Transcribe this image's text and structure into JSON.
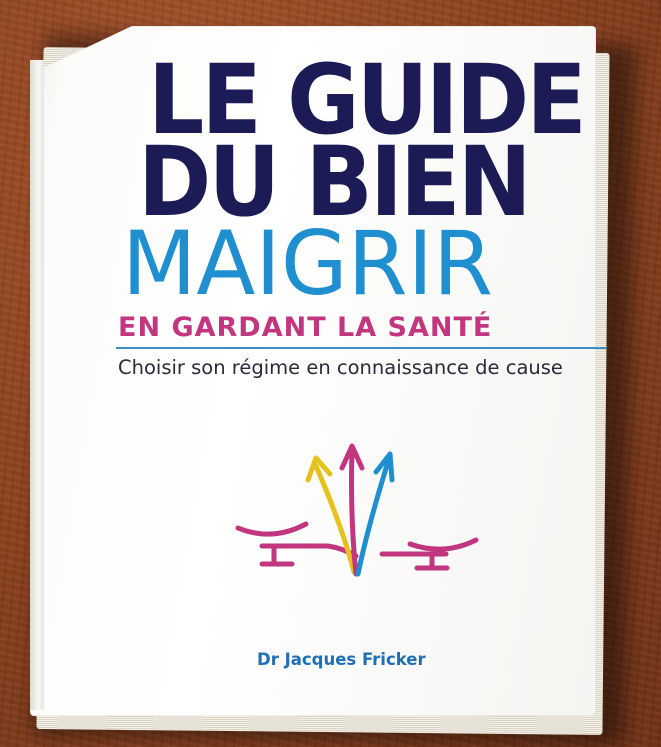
{
  "book": {
    "title_line_1": "LE GUIDE",
    "title_line_2": "DU BIEN",
    "title_line_3": "MAIGRIR",
    "title_line_4": "EN GARDANT LA SANTÉ",
    "subtitle": "Choisir son régime en connaissance de cause",
    "author": "Dr Jacques Fricker"
  },
  "colors": {
    "title_dark": "#1d1b56",
    "title_blue": "#1f8fd0",
    "title_magenta": "#c2357f",
    "logo_yellow": "#e8c21c",
    "logo_magenta": "#c2357f",
    "logo_blue": "#1f8fd0",
    "table_wood": "#8a3f1c"
  }
}
